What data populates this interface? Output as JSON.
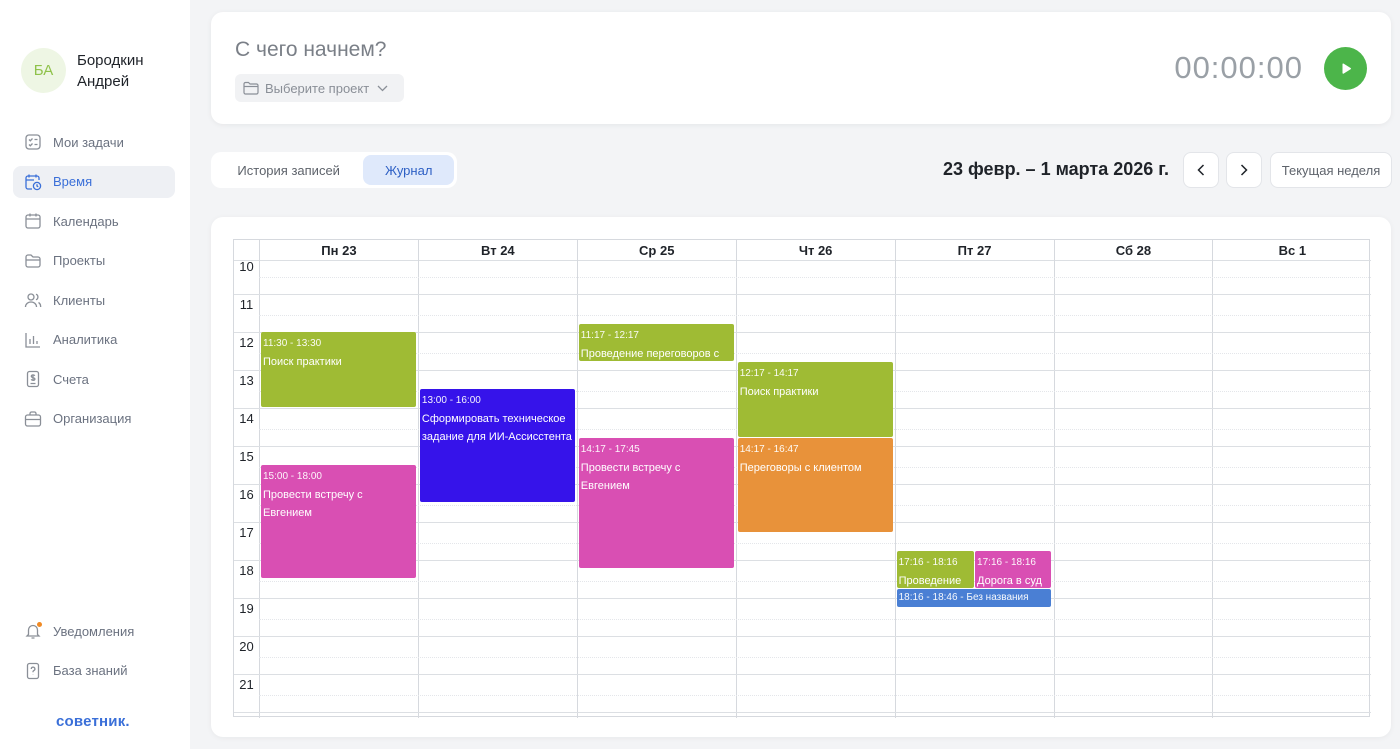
{
  "user": {
    "initials": "БА",
    "name": "Бородкин Андрей"
  },
  "nav": [
    {
      "label": "Мои задачи",
      "icon": "checklist-icon",
      "active": false
    },
    {
      "label": "Время",
      "icon": "clock-calendar-icon",
      "active": true
    },
    {
      "label": "Календарь",
      "icon": "calendar-icon",
      "active": false
    },
    {
      "label": "Проекты",
      "icon": "folder-icon",
      "active": false
    },
    {
      "label": "Клиенты",
      "icon": "users-icon",
      "active": false
    },
    {
      "label": "Аналитика",
      "icon": "bar-chart-icon",
      "active": false
    },
    {
      "label": "Счета",
      "icon": "invoice-icon",
      "active": false
    },
    {
      "label": "Организация",
      "icon": "briefcase-icon",
      "active": false
    }
  ],
  "nav_bottom": [
    {
      "label": "Уведомления",
      "icon": "bell-icon"
    },
    {
      "label": "База знаний",
      "icon": "help-doc-icon"
    }
  ],
  "brand": "советник.",
  "timer": {
    "placeholder": "С чего начнем?",
    "project_placeholder": "Выберите проект",
    "clock": "00:00:00"
  },
  "tabs": {
    "history": "История записей",
    "journal": "Журнал",
    "active": "journal"
  },
  "range_title": "23 февр. – 1 марта 2026 г.",
  "current_week_label": "Текущая неделя",
  "calendar": {
    "days": [
      "Пн 23",
      "Вт 24",
      "Ср 25",
      "Чт 26",
      "Пт 27",
      "Сб 28",
      "Вс 1"
    ],
    "hours": [
      "10",
      "11",
      "12",
      "13",
      "14",
      "15",
      "16",
      "17",
      "18",
      "19",
      "20",
      "21"
    ],
    "events": [
      {
        "day": 0,
        "start": "11:30",
        "end": "13:30",
        "time": "11:30 - 13:30",
        "title": "Поиск практики",
        "color": "#9fbb34"
      },
      {
        "day": 0,
        "start": "15:00",
        "end": "18:00",
        "time": "15:00 - 18:00",
        "title": "Провести встречу с Евгением",
        "color": "#d94fb3"
      },
      {
        "day": 1,
        "start": "13:00",
        "end": "16:00",
        "time": "13:00 - 16:00",
        "title": "Сформировать техническое задание для ИИ-Ассисстента",
        "color": "#3613ea"
      },
      {
        "day": 2,
        "start": "11:17",
        "end": "12:17",
        "time": "11:17 - 12:17",
        "title": "Проведение переговоров с",
        "color": "#9fbb34"
      },
      {
        "day": 2,
        "start": "14:17",
        "end": "17:45",
        "time": "14:17 - 17:45",
        "title": "Провести встречу с Евгением",
        "color": "#d94fb3"
      },
      {
        "day": 3,
        "start": "12:17",
        "end": "14:17",
        "time": "12:17 - 14:17",
        "title": "Поиск практики",
        "color": "#9fbb34"
      },
      {
        "day": 3,
        "start": "14:17",
        "end": "16:47",
        "time": "14:17 - 16:47",
        "title": "Переговоры с клиентом",
        "color": "#e8923a"
      },
      {
        "day": 4,
        "start": "17:16",
        "end": "18:16",
        "time": "17:16 - 18:16",
        "title": "Проведение",
        "color": "#9fbb34",
        "half": "left"
      },
      {
        "day": 4,
        "start": "17:16",
        "end": "18:16",
        "time": "17:16 - 18:16",
        "title": "Дорога в суд",
        "color": "#d94fb3",
        "half": "right"
      },
      {
        "day": 4,
        "start": "18:16",
        "end": "18:46",
        "time": "18:16 - 18:46 - Без названия",
        "title": "",
        "color": "#4a7fd4",
        "compact": true
      }
    ]
  }
}
